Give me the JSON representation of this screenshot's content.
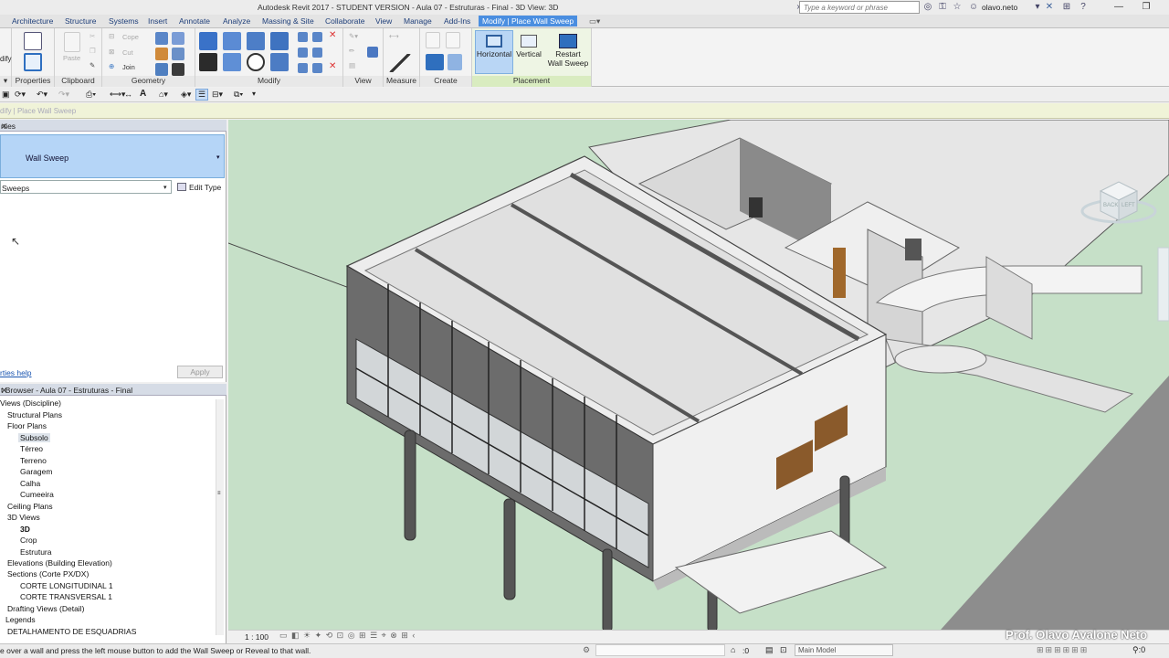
{
  "window": {
    "title": "Autodesk Revit 2017 - STUDENT VERSION -    Aula 07 - Estruturas - Final - 3D View: 3D",
    "search_placeholder": "Type a keyword or phrase",
    "user": "olavo.neto"
  },
  "ribbon_tabs": [
    "Architecture",
    "Structure",
    "Systems",
    "Insert",
    "Annotate",
    "Analyze",
    "Massing & Site",
    "Collaborate",
    "View",
    "Manage",
    "Add-Ins"
  ],
  "context_tab": "Modify | Place Wall Sweep",
  "ribbon": {
    "modify_partial": "dify",
    "panels": {
      "properties": "Properties",
      "clipboard": "Clipboard",
      "geometry": "Geometry",
      "modify": "Modify",
      "view": "View",
      "measure": "Measure",
      "create": "Create",
      "placement": "Placement"
    },
    "clipboard_paste": "Paste",
    "geometry_cope": "Cope",
    "geometry_cut": "Cut",
    "geometry_join": "Join",
    "placement_horizontal": "Horizontal",
    "placement_vertical": "Vertical",
    "placement_restart_line1": "Restart",
    "placement_restart_line2": "Wall Sweep"
  },
  "options_bar": "dify | Place Wall Sweep",
  "properties": {
    "header": "rties",
    "type_name": "Wall Sweep",
    "instance_selector": "Sweeps",
    "edit_type": "Edit Type",
    "help_link": "rties help",
    "apply": "Apply"
  },
  "browser": {
    "header": "t Browser - Aula 07 - Estruturas - Final",
    "items": [
      {
        "label": "Views (Discipline)"
      },
      {
        "label": "Structural Plans"
      },
      {
        "label": "Floor Plans"
      },
      {
        "label": "Subsolo"
      },
      {
        "label": "Térreo"
      },
      {
        "label": "Terreno"
      },
      {
        "label": "Garagem"
      },
      {
        "label": "Calha"
      },
      {
        "label": "Cumeeira"
      },
      {
        "label": "Ceiling Plans"
      },
      {
        "label": "3D Views"
      },
      {
        "label": "3D"
      },
      {
        "label": "Crop"
      },
      {
        "label": "Estrutura"
      },
      {
        "label": "Elevations (Building Elevation)"
      },
      {
        "label": "Sections (Corte PX/DX)"
      },
      {
        "label": "CORTE LONGITUDINAL 1"
      },
      {
        "label": "CORTE TRANSVERSAL 1"
      },
      {
        "label": "Drafting Views (Detail)"
      },
      {
        "label": "Legends"
      },
      {
        "label": "DETALHAMENTO DE ESQUADRIAS"
      }
    ]
  },
  "view_scale": "1 : 100",
  "status_text": "e over a wall and press the left mouse button to add the Wall Sweep or Reveal to that wall.",
  "status_zero": ":0",
  "model_selector": "Main Model",
  "viewcube": {
    "top": "BACK",
    "side": "LEFT"
  },
  "watermark": "Prof. Olavo Avalone Neto",
  "colors": {
    "ground": "#c6e0c8",
    "context_tab": "#4a8ee0",
    "type_selector": "#b5d5f7"
  }
}
